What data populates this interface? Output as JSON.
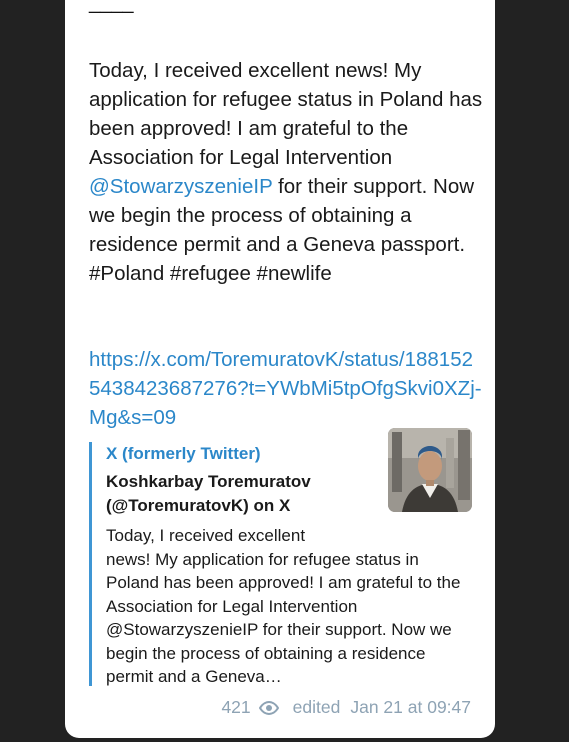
{
  "message": {
    "divider": "____",
    "text_before_mention": "Today, I received excellent news! My application for refugee status in Poland has been approved! I am grateful to the Association for Legal Intervention ",
    "mention": "@StowarzyszenieIP",
    "text_after_mention": " for their support. Now we begin the process of obtaining a residence permit and a Geneva passport.",
    "hashtags": "#Poland #refugee #newlife",
    "link": "https://x.com/ToremuratovK/status/1881525438423687276?t=YWbMi5tpOfgSkvi0XZj-Mg&s=09"
  },
  "preview": {
    "site_name": "X (formerly Twitter)",
    "title": "Koshkarbay Toremuratov (@ToremuratovK) on X",
    "description_first_line": "Today, I received excellent",
    "description_rest": "news! My application for refugee status in Poland has been approved! I am grateful to the Association for Legal Intervention @StowarzyszenieIP for their support. Now we begin the process of obtaining a residence permit and a Geneva…"
  },
  "footer": {
    "views": "421",
    "views_icon": "eye-icon",
    "edited_label": "edited",
    "timestamp": "Jan 21 at 09:47"
  },
  "colors": {
    "background": "#222222",
    "bubble": "#ffffff",
    "link": "#2b87c9",
    "accent_bar": "#3f96d4",
    "meta": "#8ea3b4"
  }
}
